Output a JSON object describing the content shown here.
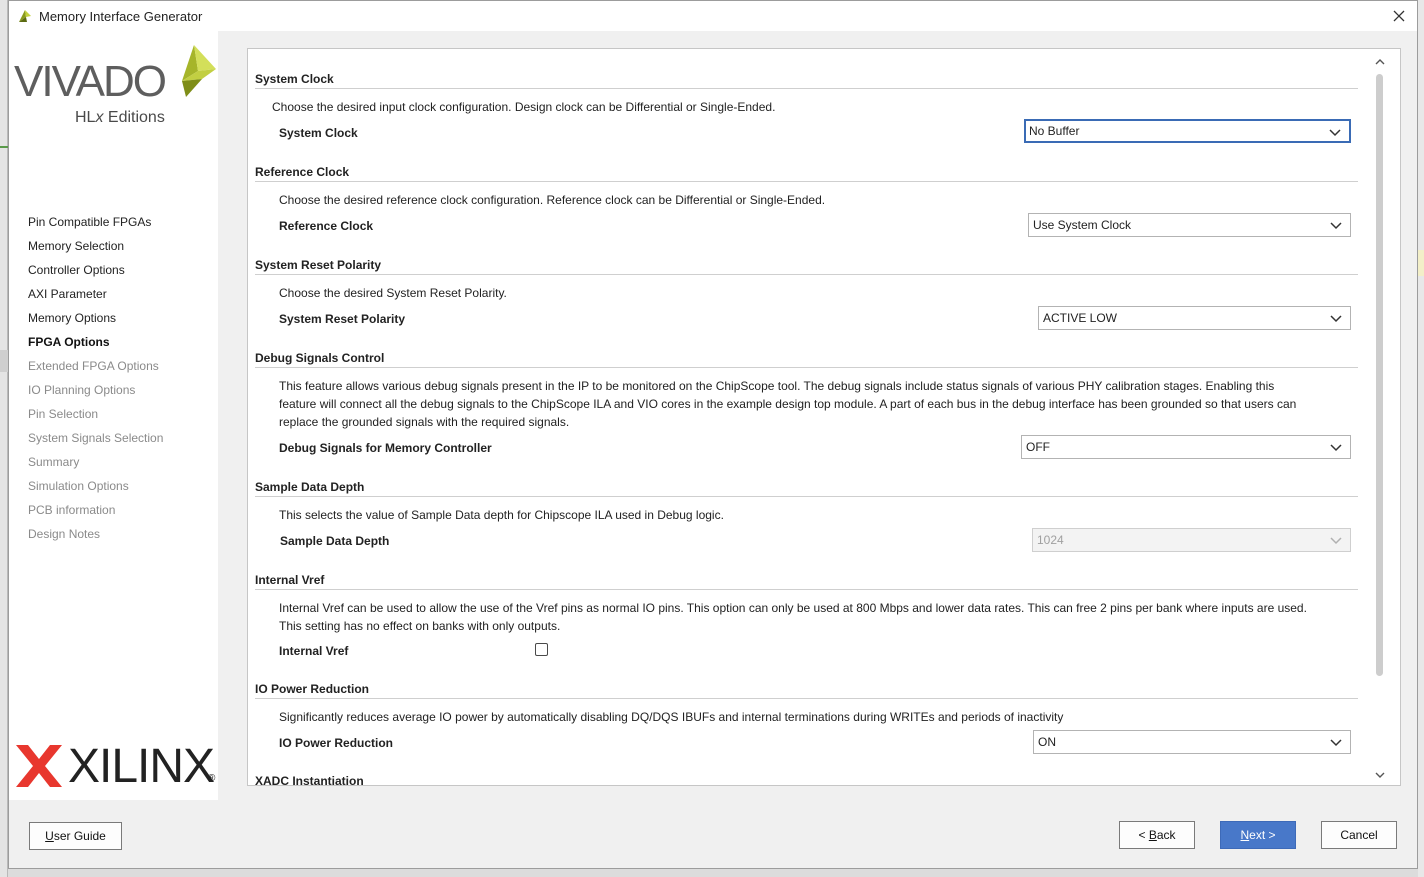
{
  "window": {
    "title": "Memory Interface Generator",
    "close_icon": "close-icon",
    "app_icon": "vivado-leaf-icon"
  },
  "branding": {
    "vivado": "VIVADO",
    "hlx_prefix": "HL",
    "hlx_x": "x",
    "hlx_suffix": " Editions",
    "xilinx": "XILINX",
    "registered": "®",
    "colors": {
      "leaf_green": "#b5c334",
      "xilinx_red": "#e8372e"
    }
  },
  "sidebar": {
    "items": [
      {
        "label": "Pin Compatible FPGAs",
        "state": "done"
      },
      {
        "label": "Memory Selection",
        "state": "done"
      },
      {
        "label": "Controller Options",
        "state": "done"
      },
      {
        "label": "AXI Parameter",
        "state": "done"
      },
      {
        "label": "Memory Options",
        "state": "done"
      },
      {
        "label": "FPGA Options",
        "state": "current"
      },
      {
        "label": "Extended FPGA Options",
        "state": "future"
      },
      {
        "label": "IO Planning Options",
        "state": "future"
      },
      {
        "label": "Pin Selection",
        "state": "future"
      },
      {
        "label": "System Signals Selection",
        "state": "future"
      },
      {
        "label": "Summary",
        "state": "future"
      },
      {
        "label": "Simulation Options",
        "state": "future"
      },
      {
        "label": "PCB information",
        "state": "future"
      },
      {
        "label": "Design Notes",
        "state": "future"
      }
    ]
  },
  "sections": {
    "system_clock": {
      "title": "System Clock",
      "desc": "Choose the desired input clock configuration. Design clock can be Differential or Single-Ended.",
      "label": "System Clock",
      "value": "No Buffer"
    },
    "reference_clock": {
      "title": "Reference Clock",
      "desc": "Choose the desired reference clock configuration. Reference clock can be Differential or Single-Ended.",
      "label": "Reference Clock",
      "value": "Use System Clock"
    },
    "reset_polarity": {
      "title": "System Reset Polarity",
      "desc": "Choose the desired System Reset Polarity.",
      "label": "System Reset Polarity",
      "value": "ACTIVE LOW"
    },
    "debug": {
      "title": "Debug Signals Control",
      "desc_line1": "This feature allows various debug signals present in the IP to be monitored on the ChipScope tool. The debug signals include status signals of various PHY calibration stages. Enabling this",
      "desc_line2": "feature will connect all the debug signals to the ChipScope ILA and VIO cores in the example design top module. A part of each bus in the debug interface has been grounded so that users can",
      "desc_line3": "replace the grounded signals with the required signals.",
      "label": "Debug Signals for Memory Controller",
      "value": "OFF"
    },
    "sample_depth": {
      "title": "Sample Data Depth",
      "desc": "This selects the value of Sample Data depth for Chipscope ILA used in Debug logic.",
      "label": "Sample Data Depth",
      "value": "1024"
    },
    "internal_vref": {
      "title": "Internal Vref",
      "desc_line1": "Internal Vref can be used to allow the use of the Vref pins as normal IO pins. This option can only be used at 800 Mbps and lower data rates. This can free 2 pins per bank where inputs are used.",
      "desc_line2": "This setting has no effect on banks with only outputs.",
      "label": "Internal Vref",
      "checked": false
    },
    "io_power": {
      "title": "IO Power Reduction",
      "desc": "Significantly reduces average IO power by automatically disabling DQ/DQS IBUFs and internal terminations during WRITEs and periods of inactivity",
      "label": "IO Power Reduction",
      "value": "ON"
    },
    "xadc": {
      "title": "XADC Instantiation"
    }
  },
  "footer": {
    "user_guide": {
      "mnemonic": "U",
      "rest": "ser Guide"
    },
    "back": {
      "prefix": "< ",
      "mnemonic": "B",
      "rest": "ack"
    },
    "next": {
      "mnemonic": "N",
      "rest": "ext >"
    },
    "cancel": "Cancel"
  }
}
